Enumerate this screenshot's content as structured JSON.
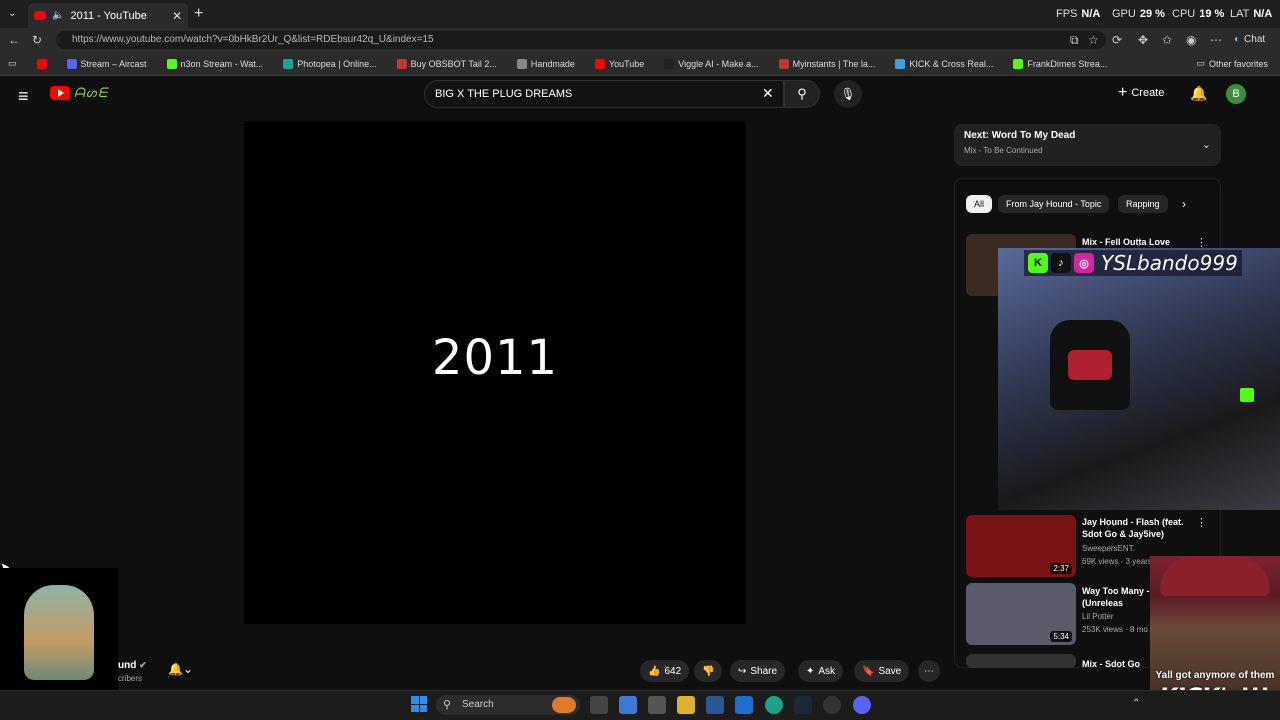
{
  "browser": {
    "tab_title": "2011 - YouTube",
    "url": "https://www.youtube.com/watch?v=0bHkBr2Ur_Q&list=RDEbsur42q_U&index=15",
    "stats": {
      "fps_label": "FPS",
      "fps_value": "N/A",
      "gpu_label": "GPU",
      "gpu_value": "29 %",
      "cpu_label": "CPU",
      "cpu_value": "19 %",
      "lat_label": "LAT",
      "lat_value": "N/A"
    },
    "chat_label": "Chat",
    "bookmarks": [
      {
        "label": "Stream – Aircast",
        "color": "#5865f2"
      },
      {
        "label": "n3on Stream - Wat...",
        "color": "#53fc18"
      },
      {
        "label": "Photopea | Online...",
        "color": "#18a497"
      },
      {
        "label": "Buy OBSBOT Tail 2...",
        "color": "#c0392b"
      },
      {
        "label": "Handmade",
        "color": "#888888"
      },
      {
        "label": "YouTube",
        "color": "#ff0000"
      },
      {
        "label": "Viggle AI - Make a...",
        "color": "#222222"
      },
      {
        "label": "Myinstants | The la...",
        "color": "#c0392b"
      },
      {
        "label": "KICK & Cross Real...",
        "color": "#3aa0e0"
      },
      {
        "label": "FrankDimes Strea...",
        "color": "#53fc18"
      }
    ],
    "other_favorites": "Other favorites"
  },
  "youtube": {
    "search_query": "BIG X THE PLUG DREAMS",
    "create_label": "Create",
    "avatar_letter": "B",
    "video_text": "2011",
    "channel_fragment": "und",
    "subscribers_fragment": "cribers",
    "actions": {
      "likes": "642",
      "share": "Share",
      "ask": "Ask",
      "save": "Save"
    },
    "next": {
      "title": "Next: Word To My Dead",
      "subtitle": "Mix - To Be Continued"
    },
    "chips": [
      "All",
      "From Jay Hound - Topic",
      "Rapping"
    ],
    "recommendations": [
      {
        "title": "Mix - Fell Outta Love",
        "channel": "",
        "views": "",
        "duration": "",
        "thumb": "#3a2a22"
      },
      {
        "title": "Jay Hound - Flash (feat. Sdot Go & Jay5ive)",
        "channel": "SweepersENT.",
        "views": "69K views · 3 years",
        "duration": "2:37",
        "thumb": "#7a1414"
      },
      {
        "title": "Way Too Many - WRLD (Unreleas",
        "channel": "Lil Potter",
        "views": "253K views · 8 mo",
        "duration": "5:34",
        "thumb": "#5a5a6a"
      },
      {
        "title": "Mix - Sdot Go",
        "channel": "",
        "views": "",
        "duration": "",
        "thumb": "#333333"
      }
    ]
  },
  "overlays": {
    "cam_handle": "YSLbando999",
    "meme_caption": "Yall got anymore of them",
    "meme_big": "KICK's!!!"
  },
  "taskbar": {
    "search_placeholder": "Search"
  }
}
